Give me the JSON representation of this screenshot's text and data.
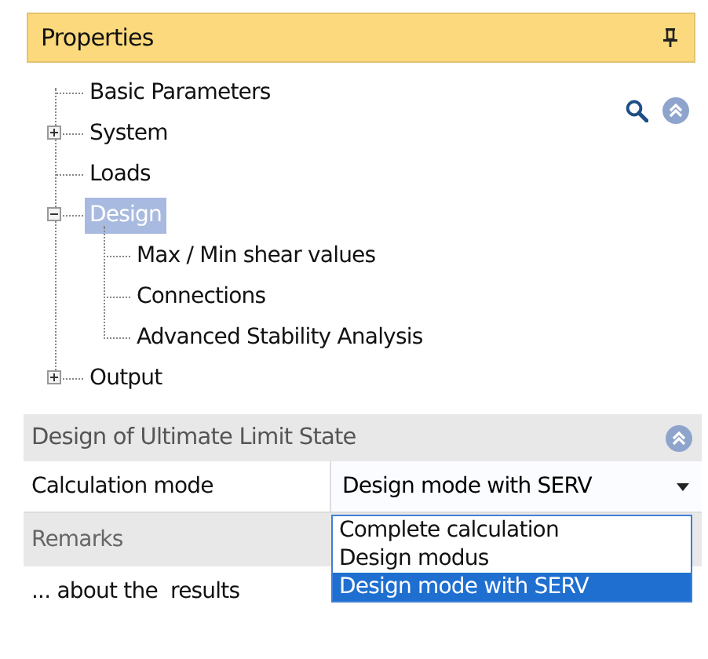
{
  "panel": {
    "title": "Properties"
  },
  "tree": [
    {
      "label": "Basic Parameters",
      "selected": false
    },
    {
      "label": "System",
      "selected": false,
      "expanded": false
    },
    {
      "label": "Loads",
      "selected": false
    },
    {
      "label": "Design",
      "selected": true,
      "expanded": true,
      "children": [
        {
          "label": "Max / Min shear values",
          "selected": false
        },
        {
          "label": "Connections",
          "selected": false
        },
        {
          "label": "Advanced Stability Analysis",
          "selected": false
        }
      ]
    },
    {
      "label": "Output",
      "selected": false,
      "expanded": false
    }
  ],
  "section": {
    "title": "Design of Ultimate Limit State"
  },
  "properties": [
    {
      "kind": "dropdown",
      "label": "Calculation mode",
      "value": "Design mode with SERV",
      "open": true,
      "options": [
        {
          "label": "Complete calculation",
          "selected": false
        },
        {
          "label": "Design modus",
          "selected": false
        },
        {
          "label": "Design mode with SERV",
          "selected": true
        }
      ]
    }
  ],
  "remarks": {
    "title": "Remarks",
    "text": "... about the  results"
  }
}
